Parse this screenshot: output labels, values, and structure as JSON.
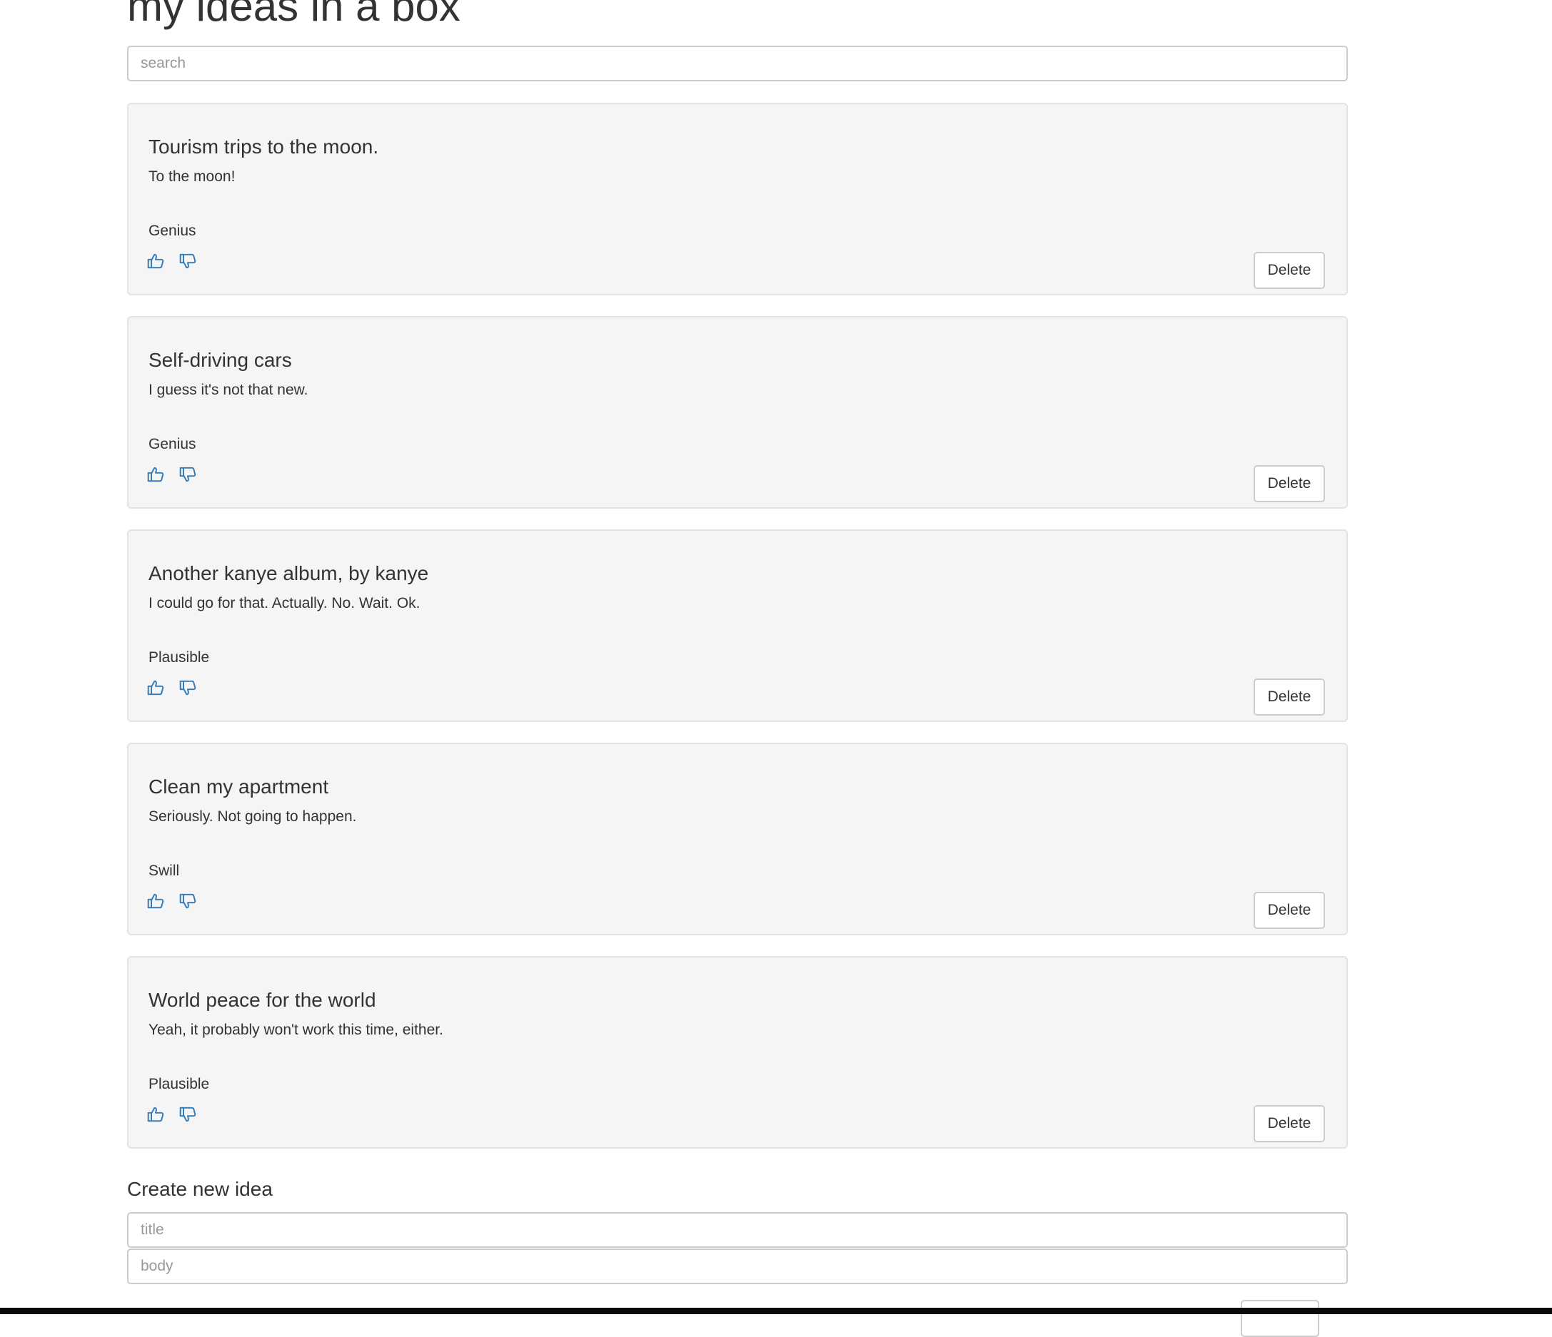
{
  "app": {
    "title": "my ideas in a box"
  },
  "search": {
    "placeholder": "search",
    "value": ""
  },
  "ideas": [
    {
      "title": "Tourism trips to the moon.",
      "body": "To the moon!",
      "quality": "Genius",
      "delete_label": "Delete"
    },
    {
      "title": "Self-driving cars",
      "body": "I guess it's not that new.",
      "quality": "Genius",
      "delete_label": "Delete"
    },
    {
      "title": "Another kanye album, by kanye",
      "body": "I could go for that. Actually. No. Wait. Ok.",
      "quality": "Plausible",
      "delete_label": "Delete"
    },
    {
      "title": "Clean my apartment",
      "body": "Seriously. Not going to happen.",
      "quality": "Swill",
      "delete_label": "Delete"
    },
    {
      "title": "World peace for the world",
      "body": "Yeah, it probably won't work this time, either.",
      "quality": "Plausible",
      "delete_label": "Delete"
    }
  ],
  "create": {
    "heading": "Create new idea",
    "title_placeholder": "title",
    "body_placeholder": "body"
  },
  "icons": {
    "upvote": "thumbs-up-icon",
    "downvote": "thumbs-down-icon"
  },
  "colors": {
    "accent": "#337ab7",
    "card_background": "#f5f5f5",
    "card_border": "#e3e3e3",
    "text": "#333333"
  }
}
